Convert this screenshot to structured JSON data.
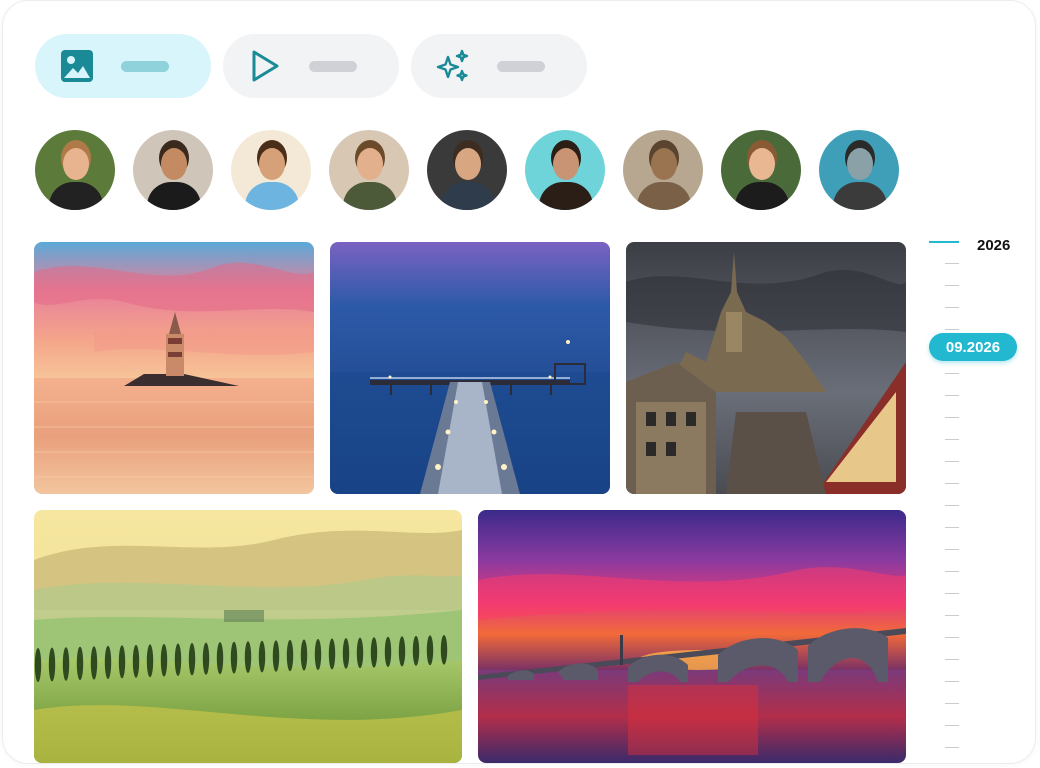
{
  "tabs": [
    {
      "name": "photos",
      "icon": "image-icon",
      "active": true
    },
    {
      "name": "videos",
      "icon": "play-icon",
      "active": false
    },
    {
      "name": "ai",
      "icon": "sparkles-icon",
      "active": false
    }
  ],
  "people": [
    {
      "id": "person-1",
      "skin": "#e8b48f",
      "hair": "#b07a48",
      "shirt": "#222222",
      "bg": "#5c7a3a"
    },
    {
      "id": "person-2",
      "skin": "#c48a62",
      "hair": "#3a2a1e",
      "shirt": "#1b1b1b",
      "bg": "#cfc5b8"
    },
    {
      "id": "person-3",
      "skin": "#d6a179",
      "hair": "#4a2e1a",
      "shirt": "#6db4e0",
      "bg": "#f3e9d6"
    },
    {
      "id": "person-4",
      "skin": "#e2b08c",
      "hair": "#6b4a2a",
      "shirt": "#4d5a3a",
      "bg": "#d8c7b3"
    },
    {
      "id": "person-5",
      "skin": "#d9a682",
      "hair": "#3d2c20",
      "shirt": "#2f3c4c",
      "bg": "#3a3a3a"
    },
    {
      "id": "person-6",
      "skin": "#c99473",
      "hair": "#2a1e16",
      "shirt": "#2a1e16",
      "bg": "#6fd3da"
    },
    {
      "id": "cat",
      "skin": "#9a7350",
      "hair": "#5a4430",
      "shirt": "#7b6048",
      "bg": "#b8a790"
    },
    {
      "id": "person-7",
      "skin": "#e9b893",
      "hair": "#8a5a34",
      "shirt": "#1c1c1c",
      "bg": "#4b6a3a"
    },
    {
      "id": "person-8",
      "skin": "#8aa1a8",
      "hair": "#2a2a2a",
      "shirt": "#3b3b3b",
      "bg": "#3f9fb8"
    }
  ],
  "timeline": {
    "year": "2026",
    "current_date": "09.2026",
    "accent": "#22b8cf"
  },
  "colors": {
    "accent": "#22b8cf",
    "active_tab_bg": "#d7f5fb",
    "icon_color": "#1a8a96"
  }
}
